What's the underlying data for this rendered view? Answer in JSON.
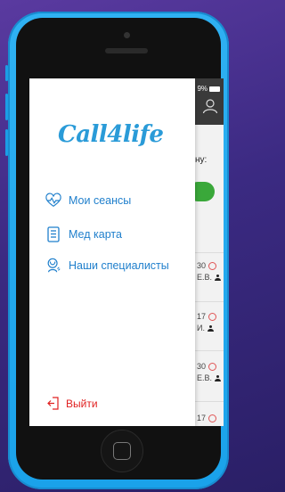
{
  "status_bar": {
    "battery_text": "9%"
  },
  "app": {
    "prompt_fragment": "ну:",
    "rows": [
      {
        "time": "30",
        "name": "Е.В."
      },
      {
        "time": "17",
        "name": "И."
      },
      {
        "time": "30",
        "name": "Е.В."
      },
      {
        "time": "17",
        "name": ""
      }
    ]
  },
  "drawer": {
    "logo_text": "Call4life",
    "menu": [
      {
        "label": "Мои сеансы",
        "icon": "heart-pulse-icon"
      },
      {
        "label": "Мед карта",
        "icon": "medical-card-icon"
      },
      {
        "label": "Наши специалисты",
        "icon": "specialist-icon"
      }
    ],
    "logout_label": "Выйти"
  },
  "colors": {
    "accent": "#1f7fcc",
    "logout": "#e02020",
    "phone_body": "#2fb1f2",
    "status_green": "#3aa83a"
  }
}
